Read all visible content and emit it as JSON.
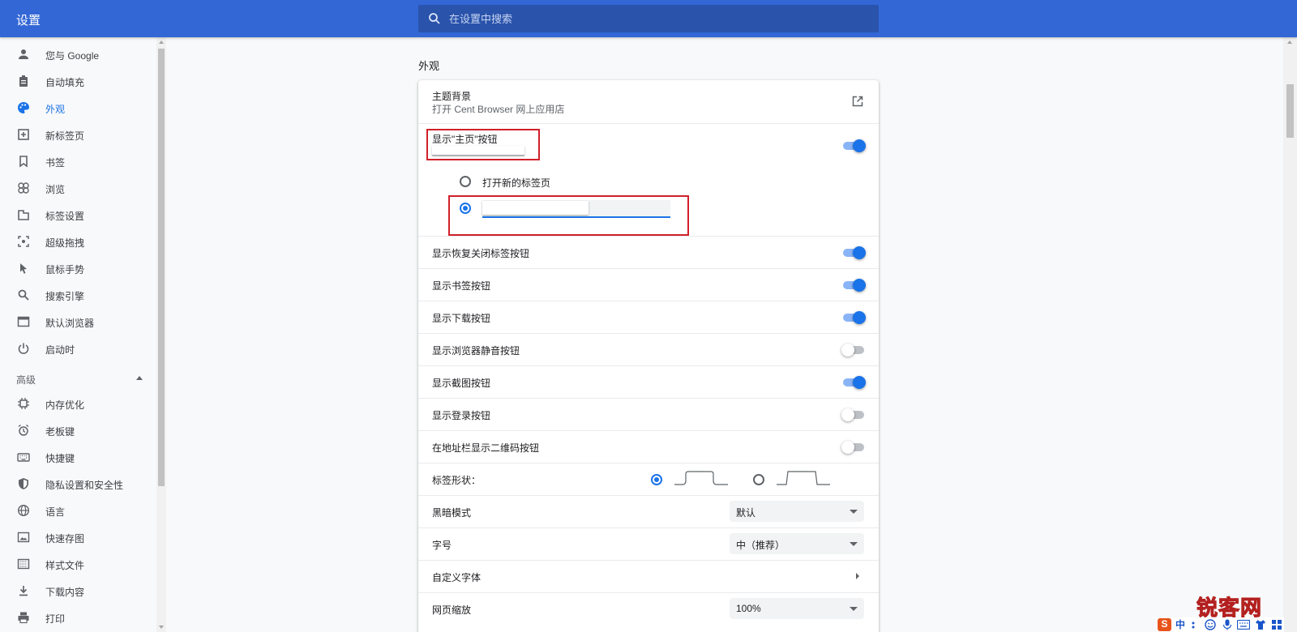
{
  "header": {
    "title": "设置",
    "search_placeholder": "在设置中搜索"
  },
  "sidebar": {
    "items": [
      {
        "label": "您与 Google",
        "icon": "person-icon"
      },
      {
        "label": "自动填充",
        "icon": "clipboard-icon"
      },
      {
        "label": "外观",
        "icon": "palette-icon",
        "active": true
      },
      {
        "label": "新标签页",
        "icon": "new-tab-icon"
      },
      {
        "label": "书签",
        "icon": "bookmark-icon"
      },
      {
        "label": "浏览",
        "icon": "browse-icon"
      },
      {
        "label": "标签设置",
        "icon": "tab-icon"
      },
      {
        "label": "超级拖拽",
        "icon": "drag-icon"
      },
      {
        "label": "鼠标手势",
        "icon": "cursor-icon"
      },
      {
        "label": "搜索引擎",
        "icon": "search-icon"
      },
      {
        "label": "默认浏览器",
        "icon": "browser-window-icon"
      },
      {
        "label": "启动时",
        "icon": "power-icon"
      }
    ],
    "advanced_label": "高级",
    "advanced_items": [
      {
        "label": "内存优化",
        "icon": "chip-icon"
      },
      {
        "label": "老板键",
        "icon": "alarm-icon"
      },
      {
        "label": "快捷键",
        "icon": "keyboard-icon"
      },
      {
        "label": "隐私设置和安全性",
        "icon": "shield-icon"
      },
      {
        "label": "语言",
        "icon": "globe-icon"
      },
      {
        "label": "快速存图",
        "icon": "image-icon"
      },
      {
        "label": "样式文件",
        "icon": "style-file-icon"
      },
      {
        "label": "下载内容",
        "icon": "download-icon"
      },
      {
        "label": "打印",
        "icon": "print-icon"
      }
    ]
  },
  "main": {
    "section_title": "外观",
    "theme": {
      "label": "主题背景",
      "sub": "打开 Cent Browser 网上应用店"
    },
    "home_button": {
      "label": "显示\"主页\"按钮",
      "enabled": true,
      "option_new_tab": "打开新的标签页",
      "custom_url_value": ""
    },
    "toggles": [
      {
        "label": "显示恢复关闭标签按钮",
        "on": true
      },
      {
        "label": "显示书签按钮",
        "on": true
      },
      {
        "label": "显示下载按钮",
        "on": true
      },
      {
        "label": "显示浏览器静音按钮",
        "on": false
      },
      {
        "label": "显示截图按钮",
        "on": true
      },
      {
        "label": "显示登录按钮",
        "on": false
      },
      {
        "label": "在地址栏显示二维码按钮",
        "on": false
      }
    ],
    "tab_shape_label": "标签形状：",
    "dark_mode": {
      "label": "黑暗模式",
      "value": "默认"
    },
    "font_size": {
      "label": "字号",
      "value": "中（推荐）"
    },
    "custom_fonts": {
      "label": "自定义字体"
    },
    "zoom": {
      "label": "网页缩放",
      "value": "100%"
    }
  },
  "watermark": {
    "text": "锐客网"
  },
  "tray": {
    "ime_label": "中"
  },
  "colors": {
    "header_bg": "#3367d6",
    "accent": "#1a73e8",
    "highlight": "#d0202a"
  }
}
